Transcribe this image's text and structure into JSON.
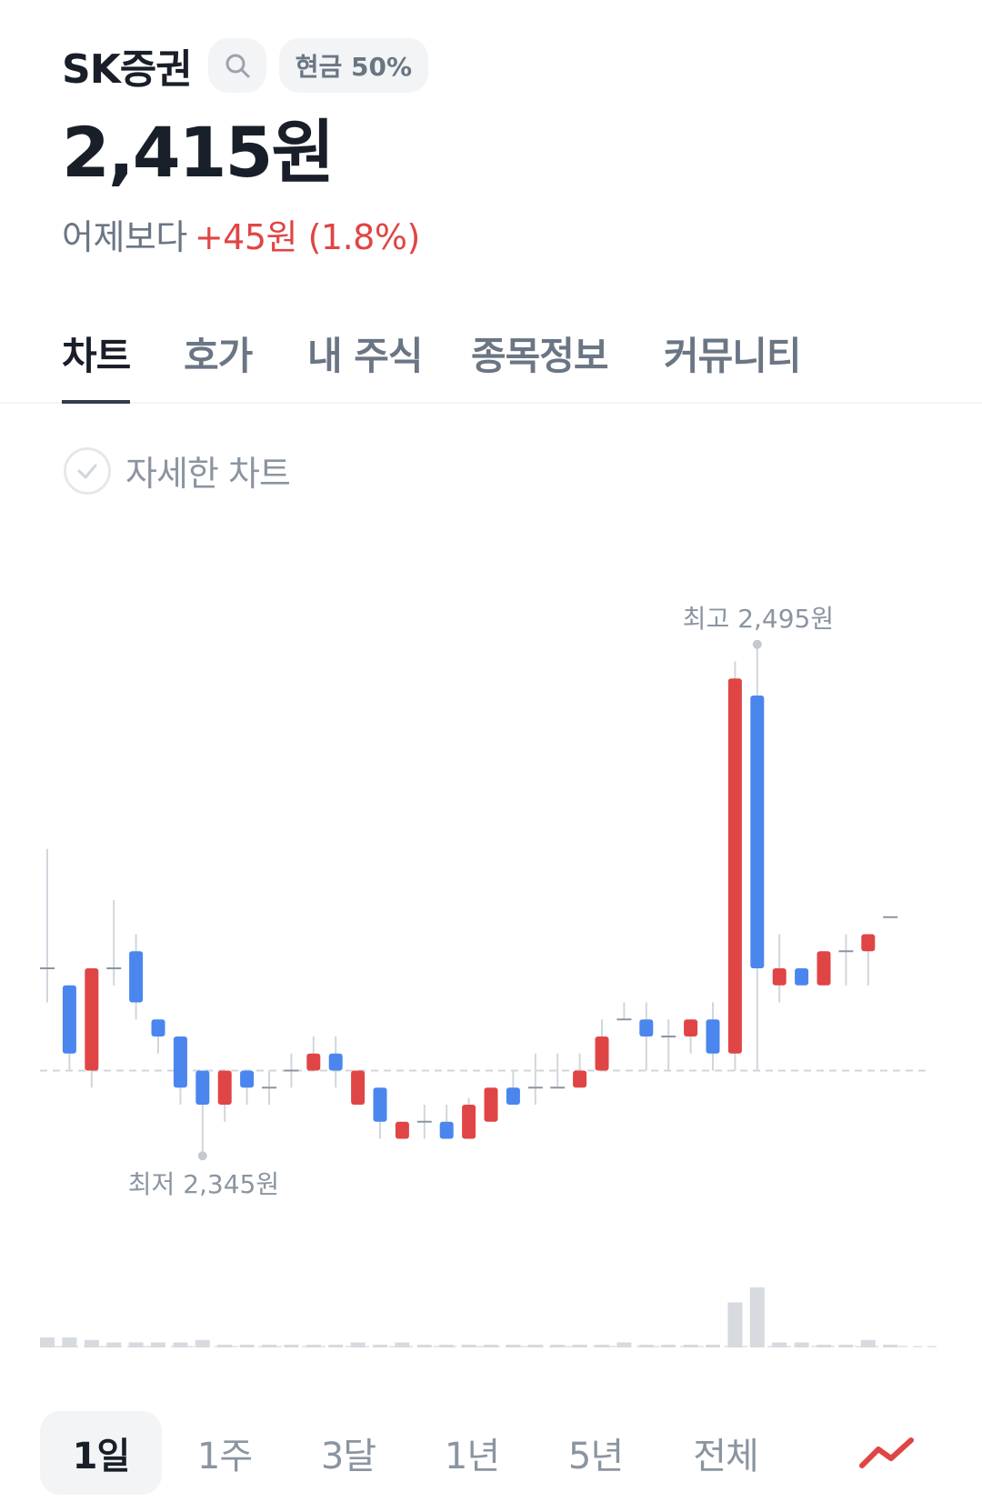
{
  "header": {
    "stock_name": "SK증권",
    "cash_badge": "현금 50%",
    "price": "2,415원",
    "change_prefix": "어제보다",
    "change_value": "+45원 (1.8%)"
  },
  "tabs": [
    "차트",
    "호가",
    "내 주식",
    "종목정보",
    "커뮤니티"
  ],
  "detail_chart_label": "자세한 차트",
  "periods": [
    "1일",
    "1주",
    "3달",
    "1년",
    "5년",
    "전체"
  ],
  "icons": {
    "search": "search-icon",
    "check": "check-circle-icon",
    "chart_type": "line-chart-icon"
  },
  "colors": {
    "up": "#e04545",
    "down": "#4a86ed",
    "neutral": "#9aa3ad",
    "volume": "#d7dadf"
  },
  "chart_data": {
    "type": "candlestick",
    "high_label": "최고 2,495원",
    "low_label": "최저 2,345원",
    "reference_price": 2370,
    "ylim": [
      2340,
      2500
    ],
    "candles": [
      {
        "o": 2400,
        "h": 2435,
        "l": 2390,
        "c": 2400
      },
      {
        "o": 2395,
        "h": 2395,
        "l": 2370,
        "c": 2375
      },
      {
        "o": 2370,
        "h": 2400,
        "l": 2365,
        "c": 2400
      },
      {
        "o": 2400,
        "h": 2420,
        "l": 2395,
        "c": 2400
      },
      {
        "o": 2405,
        "h": 2410,
        "l": 2385,
        "c": 2390
      },
      {
        "o": 2385,
        "h": 2385,
        "l": 2375,
        "c": 2380
      },
      {
        "o": 2380,
        "h": 2380,
        "l": 2360,
        "c": 2365
      },
      {
        "o": 2370,
        "h": 2370,
        "l": 2345,
        "c": 2360
      },
      {
        "o": 2360,
        "h": 2370,
        "l": 2355,
        "c": 2370
      },
      {
        "o": 2370,
        "h": 2370,
        "l": 2360,
        "c": 2365
      },
      {
        "o": 2365,
        "h": 2370,
        "l": 2360,
        "c": 2365
      },
      {
        "o": 2370,
        "h": 2375,
        "l": 2365,
        "c": 2370
      },
      {
        "o": 2370,
        "h": 2380,
        "l": 2370,
        "c": 2375
      },
      {
        "o": 2375,
        "h": 2380,
        "l": 2365,
        "c": 2370
      },
      {
        "o": 2360,
        "h": 2370,
        "l": 2360,
        "c": 2370
      },
      {
        "o": 2365,
        "h": 2365,
        "l": 2350,
        "c": 2355
      },
      {
        "o": 2350,
        "h": 2355,
        "l": 2350,
        "c": 2355
      },
      {
        "o": 2355,
        "h": 2360,
        "l": 2350,
        "c": 2355
      },
      {
        "o": 2355,
        "h": 2360,
        "l": 2350,
        "c": 2350
      },
      {
        "o": 2350,
        "h": 2362,
        "l": 2350,
        "c": 2360
      },
      {
        "o": 2355,
        "h": 2365,
        "l": 2355,
        "c": 2365
      },
      {
        "o": 2365,
        "h": 2370,
        "l": 2360,
        "c": 2360
      },
      {
        "o": 2365,
        "h": 2375,
        "l": 2360,
        "c": 2365
      },
      {
        "o": 2365,
        "h": 2375,
        "l": 2365,
        "c": 2365
      },
      {
        "o": 2365,
        "h": 2375,
        "l": 2365,
        "c": 2370
      },
      {
        "o": 2370,
        "h": 2385,
        "l": 2370,
        "c": 2380
      },
      {
        "o": 2385,
        "h": 2390,
        "l": 2385,
        "c": 2385
      },
      {
        "o": 2385,
        "h": 2390,
        "l": 2370,
        "c": 2380
      },
      {
        "o": 2380,
        "h": 2385,
        "l": 2370,
        "c": 2380
      },
      {
        "o": 2380,
        "h": 2385,
        "l": 2375,
        "c": 2385
      },
      {
        "o": 2385,
        "h": 2390,
        "l": 2370,
        "c": 2375
      },
      {
        "o": 2375,
        "h": 2490,
        "l": 2370,
        "c": 2485
      },
      {
        "o": 2480,
        "h": 2495,
        "l": 2370,
        "c": 2400
      },
      {
        "o": 2395,
        "h": 2410,
        "l": 2390,
        "c": 2400
      },
      {
        "o": 2400,
        "h": 2400,
        "l": 2395,
        "c": 2395
      },
      {
        "o": 2395,
        "h": 2405,
        "l": 2395,
        "c": 2405
      },
      {
        "o": 2405,
        "h": 2410,
        "l": 2395,
        "c": 2405
      },
      {
        "o": 2405,
        "h": 2410,
        "l": 2395,
        "c": 2410
      },
      {
        "o": 2415,
        "h": 2415,
        "l": 2415,
        "c": 2415
      }
    ],
    "volume": [
      4,
      4,
      3,
      2,
      2,
      2,
      2,
      3,
      1,
      1,
      1,
      1,
      1,
      1,
      2,
      1,
      2,
      1,
      1,
      1,
      1,
      1,
      1,
      1,
      1,
      1,
      2,
      1,
      1,
      1,
      1,
      18,
      24,
      2,
      2,
      1,
      1,
      3,
      1
    ]
  }
}
